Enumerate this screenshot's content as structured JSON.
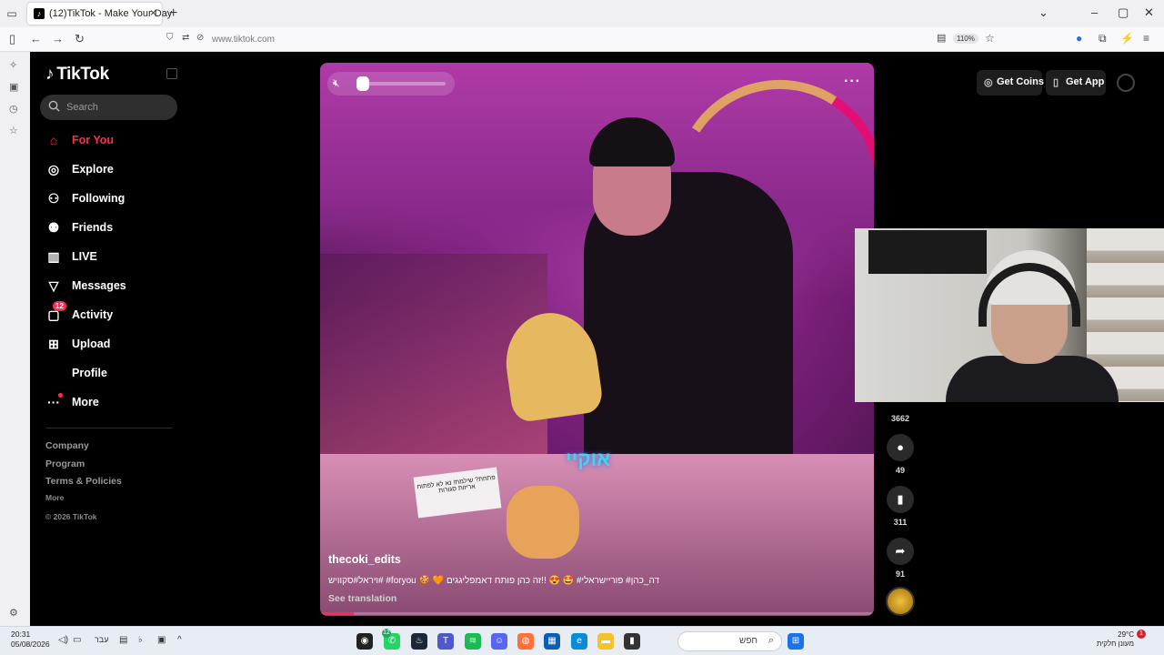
{
  "browser": {
    "tab_title": "(12)TikTok - Make Your Day",
    "url": "www.tiktok.com",
    "zoom": "110%"
  },
  "tiktok": {
    "logo": "TikTok",
    "search_placeholder": "Search",
    "nav": [
      {
        "label": "For You",
        "icon": "home-icon",
        "active": true
      },
      {
        "label": "Explore",
        "icon": "compass-icon"
      },
      {
        "label": "Following",
        "icon": "following-icon"
      },
      {
        "label": "Friends",
        "icon": "friends-icon"
      },
      {
        "label": "LIVE",
        "icon": "live-icon"
      },
      {
        "label": "Messages",
        "icon": "messages-icon"
      },
      {
        "label": "Activity",
        "icon": "activity-icon",
        "badge": "12"
      },
      {
        "label": "Upload",
        "icon": "upload-icon"
      },
      {
        "label": "Profile",
        "icon": "profile-icon"
      },
      {
        "label": "More",
        "icon": "more-icon"
      }
    ],
    "footer": {
      "company": "Company",
      "program": "Program",
      "terms": "Terms & Policies",
      "more": "More",
      "copyright": "© 2026 TikTok"
    },
    "top_right": {
      "get_coins": "Get Coins",
      "get_app": "Get App"
    },
    "video": {
      "author": "thecoki_edits",
      "description": "ויראל#סקוויש# #foryou 🍪 🧡 דה_כהן# פוריישראלי# 🤩 😍 !!זה כהן פותח דאמפליגגים",
      "see_translation": "See translation",
      "overlay_caption": "אוקיי",
      "sign_text": "פתחת? שילמת!\nנא לא לפתוח אריזות סגורות",
      "volume": 0.0,
      "progress_fraction": 0.06
    },
    "actions": {
      "likes": "3662",
      "comments": "49",
      "saves": "311",
      "shares": "91"
    }
  },
  "taskbar": {
    "time": "20:31",
    "date": "05/08/2026",
    "lang": "עבר",
    "search_label": "חפש",
    "weather_temp": "29°C",
    "weather_desc": "מעונן חלקית",
    "notification_count": "1",
    "whatsapp_badge": "12"
  }
}
